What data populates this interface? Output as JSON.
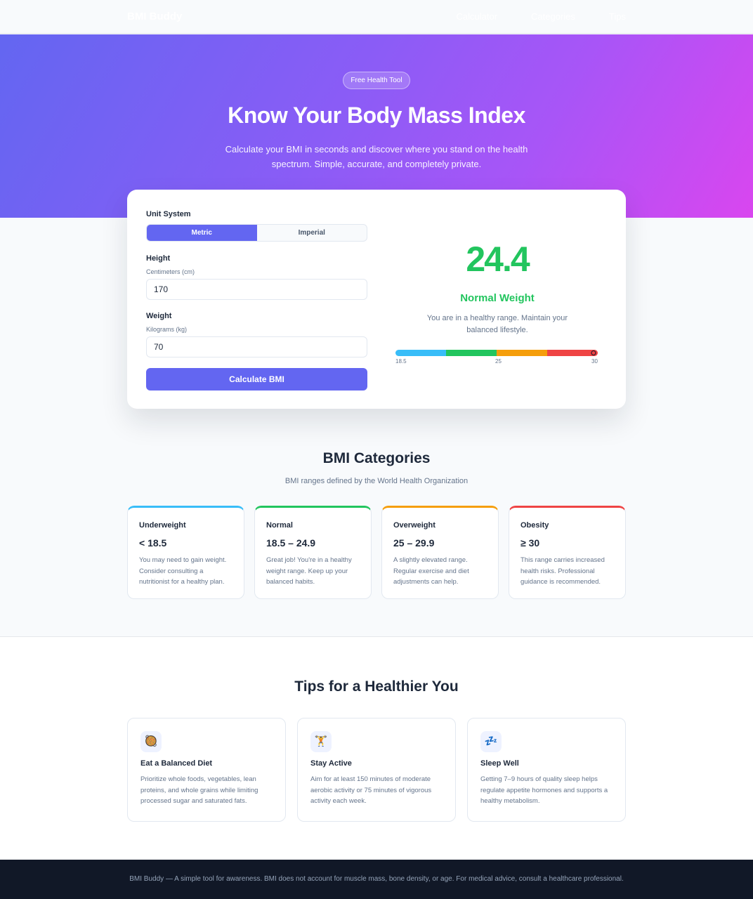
{
  "nav": {
    "brand": "BMI Buddy",
    "links": [
      "Calculator",
      "Categories",
      "Tips"
    ]
  },
  "hero": {
    "badge": "Free Health Tool",
    "title": "Know Your Body Mass Index",
    "subtitle": "Calculate your BMI in seconds and discover where you stand on the health spectrum. Simple, accurate, and completely private."
  },
  "calculator": {
    "unit_label": "Unit System",
    "units": [
      "Metric",
      "Imperial"
    ],
    "selected_unit": "Metric",
    "height_label": "Height",
    "height_unit": "Centimeters (cm)",
    "height_value": "170",
    "weight_label": "Weight",
    "weight_unit": "Kilograms (kg)",
    "weight_value": "70",
    "button_label": "Calculate BMI"
  },
  "result": {
    "bmi": "24.4",
    "category": "Normal Weight",
    "description": "You are in a healthy range. Maintain your balanced lifestyle.",
    "scale_ticks": [
      "18.5",
      "25",
      "30"
    ],
    "marker_fraction": 0.98,
    "colors": {
      "underweight": "#38bdf8",
      "normal": "#22c55e",
      "overweight": "#f59e0b",
      "obesity": "#ef4444"
    }
  },
  "categories": {
    "title": "BMI Categories",
    "subtitle": "BMI ranges defined by the World Health Organization",
    "items": [
      {
        "name": "Underweight",
        "range": "< 18.5",
        "desc": "You may need to gain weight. Consider consulting a nutritionist for a healthy plan.",
        "color": "#38bdf8"
      },
      {
        "name": "Normal",
        "range": "18.5 – 24.9",
        "desc": "Great job! You're in a healthy weight range. Keep up your balanced habits.",
        "color": "#22c55e"
      },
      {
        "name": "Overweight",
        "range": "25 – 29.9",
        "desc": "A slightly elevated range. Regular exercise and diet adjustments can help.",
        "color": "#f59e0b"
      },
      {
        "name": "Obesity",
        "range": "≥ 30",
        "desc": "This range carries increased health risks. Professional guidance is recommended.",
        "color": "#ef4444"
      }
    ]
  },
  "tips": {
    "title": "Tips for a Healthier You",
    "items": [
      {
        "icon": "🥘",
        "icon_name": "food-icon",
        "name": "Eat a Balanced Diet",
        "desc": "Prioritize whole foods, vegetables, lean proteins, and whole grains while limiting processed sugar and saturated fats."
      },
      {
        "icon": "🏋",
        "icon_name": "weightlifter-icon",
        "name": "Stay Active",
        "desc": "Aim for at least 150 minutes of moderate aerobic activity or 75 minutes of vigorous activity each week."
      },
      {
        "icon": "💤",
        "icon_name": "sleep-icon",
        "name": "Sleep Well",
        "desc": "Getting 7–9 hours of quality sleep helps regulate appetite hormones and supports a healthy metabolism."
      }
    ]
  },
  "footer": {
    "text": "BMI Buddy — A simple tool for awareness. BMI does not account for muscle mass, bone density, or age. For medical advice, consult a healthcare professional."
  }
}
